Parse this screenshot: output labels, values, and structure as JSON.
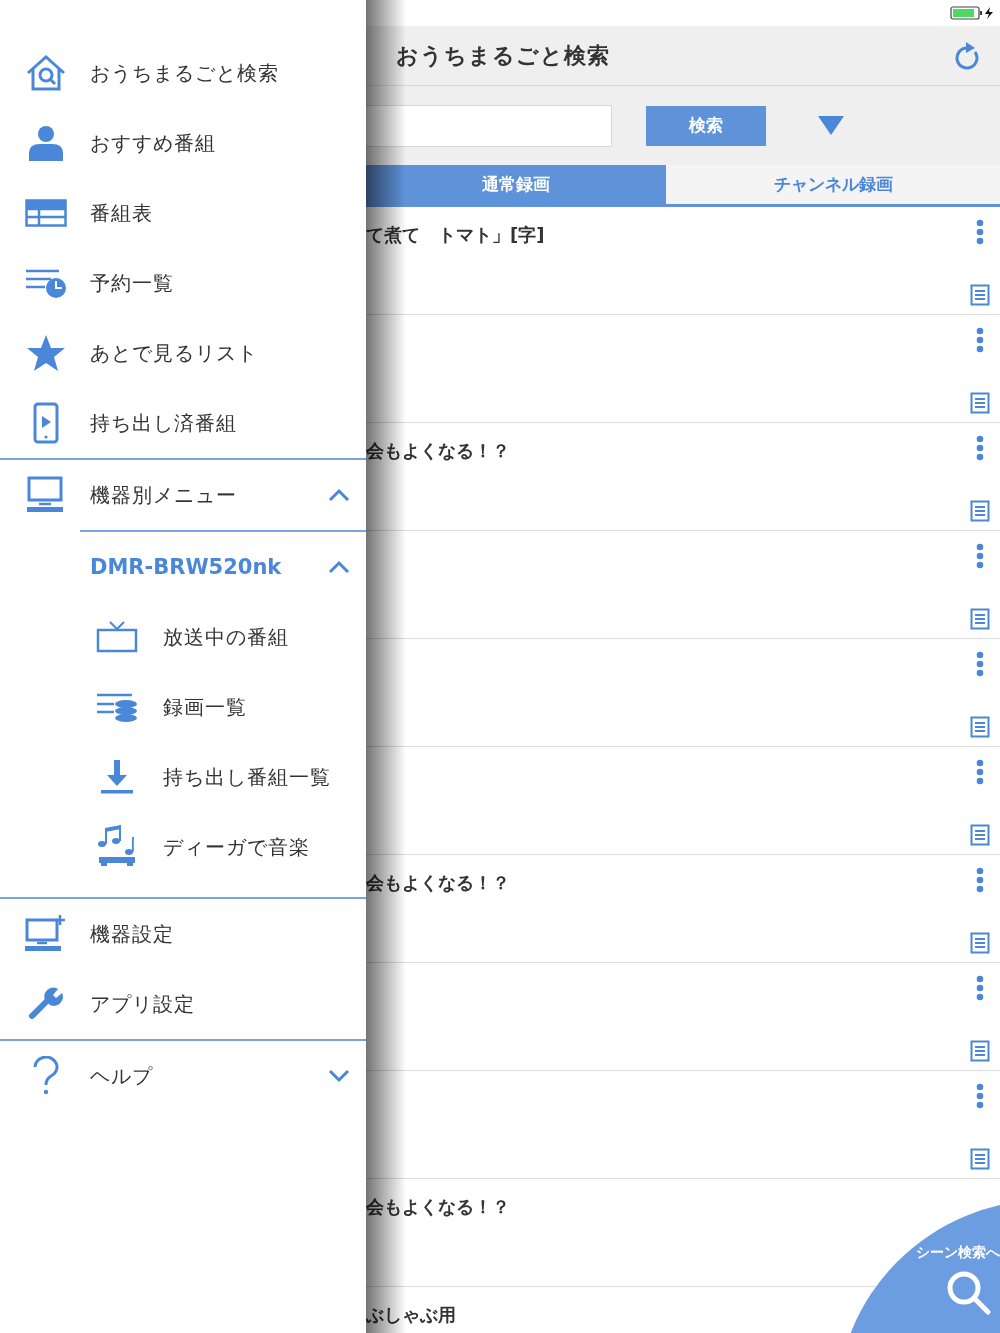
{
  "drawer": {
    "main_items": [
      {
        "label": "おうちまるごと検索"
      },
      {
        "label": "おすすめ番組"
      },
      {
        "label": "番組表"
      },
      {
        "label": "予約一覧"
      },
      {
        "label": "あとで見るリスト"
      },
      {
        "label": "持ち出し済番組"
      }
    ],
    "device_menu": {
      "label": "機器別メニュー",
      "expanded": true,
      "device": {
        "label": "DMR-BRW520nk",
        "expanded": true,
        "items": [
          {
            "label": "放送中の番組"
          },
          {
            "label": "録画一覧"
          },
          {
            "label": "持ち出し番組一覧"
          },
          {
            "label": "ディーガで音楽"
          }
        ]
      }
    },
    "settings_items": [
      {
        "label": "機器設定"
      },
      {
        "label": "アプリ設定"
      }
    ],
    "help": {
      "label": "ヘルプ",
      "expanded": false
    }
  },
  "main": {
    "title": "おうちまるごと検索",
    "search": {
      "button": "検索"
    },
    "tabs": [
      {
        "label": "通常録画",
        "selected": true
      },
      {
        "label": "チャンネル録画",
        "selected": false
      }
    ],
    "rows": [
      {
        "title": "て煮て　トマト」[字]"
      },
      {},
      {
        "title": "会もよくなる！？"
      },
      {},
      {},
      {},
      {
        "title": "会もよくなる！？"
      },
      {},
      {},
      {
        "title": "会もよくなる！？"
      },
      {
        "title": "ぶしゃぶ用"
      }
    ],
    "fab": {
      "label": "シーン検索へ"
    }
  }
}
